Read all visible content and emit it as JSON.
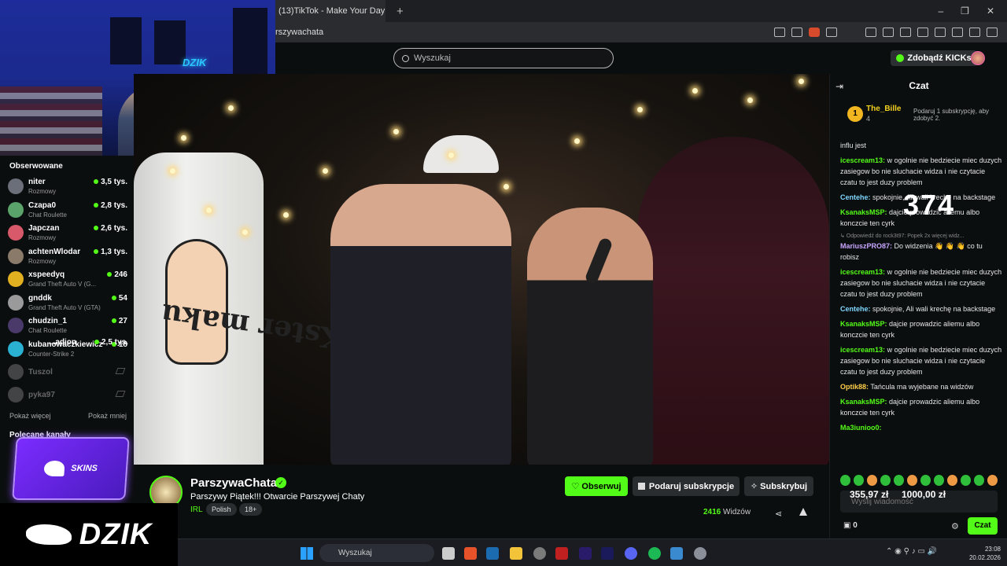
{
  "browser": {
    "tab_title": "(13)TikTok - Make Your Day",
    "new_tab": "+",
    "url": "rszywachata",
    "window_controls": [
      "–",
      "❐",
      "✕"
    ]
  },
  "topbar": {
    "search_placeholder": "Wyszukaj",
    "kicks_button": "Zdobądź KICKs"
  },
  "webcam": {
    "logo_text": "DZIK"
  },
  "sidebar": {
    "title": "Obserwowane",
    "channels": [
      {
        "name": "niter",
        "category": "Rozmowy",
        "viewers": "3,5 tys.",
        "color": "#6a6f7a"
      },
      {
        "name": "Czapa0",
        "category": "Chat Roulette",
        "viewers": "2,8 tys.",
        "color": "#5aa36a"
      },
      {
        "name": "Japczan",
        "category": "Rozmowy",
        "viewers": "2,6 tys.",
        "color": "#d85a6a"
      },
      {
        "name": "achtenWlodar",
        "category": "Rozmowy",
        "viewers": "1,3 tys.",
        "color": "#8a7a6a"
      },
      {
        "name": "xspeedyq",
        "category": "Grand Theft Auto V (G...",
        "viewers": "246",
        "color": "#e0b020"
      },
      {
        "name": "gnddk",
        "category": "Grand Theft Auto V (GTA)",
        "viewers": "54",
        "color": "#9a9a9a"
      },
      {
        "name": "chudzin_1",
        "category": "Chat Roulette",
        "viewers": "27",
        "color": "#4a3a6a"
      },
      {
        "name": "kubanowaczkiewicz",
        "category": "Counter-Strike 2",
        "viewers": "18",
        "color": "#2ab0d0"
      }
    ],
    "offline": [
      {
        "name": "Tuszol",
        "color": "#888"
      },
      {
        "name": "pyka97",
        "color": "#888"
      }
    ],
    "show_more": "Pokaż więcej",
    "show_less": "Pokaż mniej",
    "recommended_title": "Polecane kanały",
    "recommended_partial_name": "...adion",
    "recommended_partial_viewers": "2,5 tys."
  },
  "overlays": {
    "skins_label": "SKINS",
    "dzik_text": "DZIK",
    "counter": "374"
  },
  "video": {
    "banner_text": "Kster maku"
  },
  "stream": {
    "channel_name": "ParszywaChata",
    "verified": "✓",
    "title": "Parszywy Piątek!!! Otwarcie Parszywej Chaty",
    "category": "IRL",
    "tags": [
      "Polish",
      "18+"
    ],
    "follow_label": "♡ Obserwuj",
    "gift_label": "Podaruj subskrypcje",
    "subscribe_label": "✧ Subskrybuj",
    "viewers_count": "2416",
    "viewers_label": "Widzów",
    "share_icon": "share-icon",
    "report_icon": "warning-icon"
  },
  "chat": {
    "title": "Czat",
    "pinned": {
      "rank": "1",
      "user": "The_Bille",
      "count": "4",
      "message": "Podaruj 1 subskrypcję, aby zdobyć 2."
    },
    "messages": [
      {
        "user": "",
        "color": "#fff",
        "text": "influ jest"
      },
      {
        "user": "icescream13:",
        "color": "#53fc18",
        "text": "w ogolnie nie bedziecie miec duzych zasiegow bo nie sluchacie widza i nie czytacie czatu to jest duzy problem"
      },
      {
        "user": "Centehe:",
        "color": "#7fd7ff",
        "text": "spokojnie, Ali wali krechę na backstage"
      },
      {
        "user": "KsanaksMSP:",
        "color": "#53fc18",
        "text": "dajcie prowadzic aliemu albo konczcie ten cyrk"
      },
      {
        "reply": "↳ Odpowiedź do rock3t97: Popek 2x więcej widz..."
      },
      {
        "user": "MariuszPRO87:",
        "color": "#c9a6ff",
        "text": "Do widzenia 👋 👋 👋 co tu robisz"
      },
      {
        "user": "icescream13:",
        "color": "#53fc18",
        "text": "w ogolnie nie bedziecie miec duzych zasiegow bo nie sluchacie widza i nie czytacie czatu to jest duzy problem"
      },
      {
        "user": "Centehe:",
        "color": "#7fd7ff",
        "text": "spokojnie, Ali wali krechę na backstage"
      },
      {
        "user": "KsanaksMSP:",
        "color": "#53fc18",
        "text": "dajcie prowadzic aliemu albo konczcie ten cyrk"
      },
      {
        "user": "icescream13:",
        "color": "#53fc18",
        "text": "w ogolnie nie bedziecie miec duzych zasiegow bo nie sluchacie widza i nie czytacie czatu to jest duzy problem"
      },
      {
        "user": "Optik88:",
        "color": "#ffcf4a",
        "text": "Tańcula ma wyjebane na widzów"
      },
      {
        "user": "KsanaksMSP:",
        "color": "#53fc18",
        "text": "dajcie prowadzic aliemu albo konczcie ten cyrk"
      },
      {
        "user": "Ma3iunioo0:",
        "color": "#53fc18",
        "text": ""
      }
    ],
    "input_placeholder": "Wyślij wiadomość",
    "donation_1": "355,97 zł",
    "donation_2": "1000,00 zł",
    "kicks_count": "0",
    "send_label": "Czat"
  },
  "taskbar": {
    "search_placeholder": "Wyszukaj",
    "time": "23:08",
    "date": "20.02.2026"
  }
}
